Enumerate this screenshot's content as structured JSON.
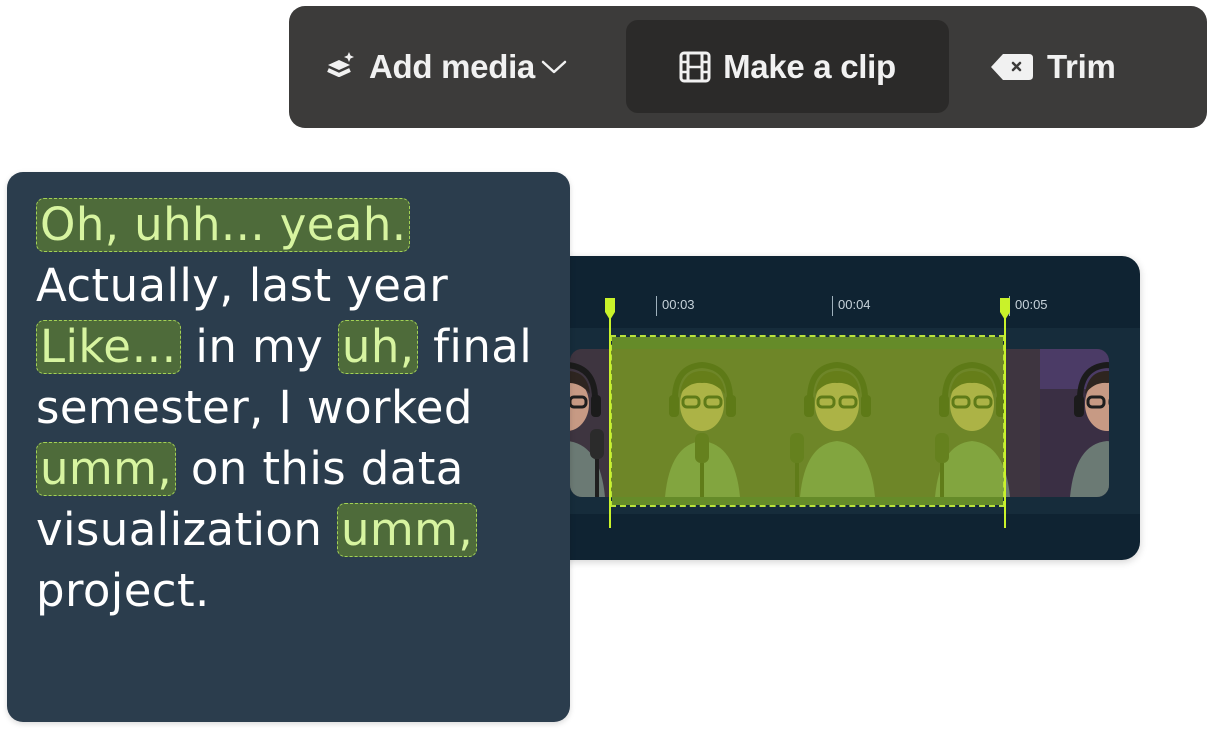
{
  "toolbar": {
    "add_media_label": "Add media",
    "make_clip_label": "Make a clip",
    "trim_label": "Trim",
    "icons": {
      "add_media": "layers-sparkle-icon",
      "dropdown": "chevron-down-icon",
      "make_clip": "film-icon",
      "trim": "backspace-icon"
    }
  },
  "timeline": {
    "ticks": [
      "00:03",
      "00:04",
      "00:05"
    ],
    "selection_color": "#c9f22a"
  },
  "transcript": {
    "lines": [
      [
        {
          "text": "Oh, uhh... yeah.",
          "filler": true
        }
      ],
      [
        {
          "text": "Actually, last year",
          "filler": false
        }
      ],
      [
        {
          "text": "Like…",
          "filler": true
        },
        {
          "text": " in my ",
          "filler": false
        },
        {
          "text": "uh,",
          "filler": true
        },
        {
          "text": " final",
          "filler": false
        }
      ],
      [
        {
          "text": "semester, I worked",
          "filler": false
        }
      ],
      [
        {
          "text": "umm,",
          "filler": true
        },
        {
          "text": " on this data",
          "filler": false
        }
      ],
      [
        {
          "text": "visualization ",
          "filler": false
        },
        {
          "text": "umm,",
          "filler": true
        }
      ],
      [
        {
          "text": "project.",
          "filler": false
        }
      ]
    ]
  },
  "colors": {
    "toolbar_bg": "#3c3b3a",
    "toolbar_active": "#2b2a29",
    "transcript_bg": "#2b3d4d",
    "filler_text": "#d7f4a0",
    "filler_bg": "#4e6b3a",
    "timeline_bg": "#0f2332"
  }
}
